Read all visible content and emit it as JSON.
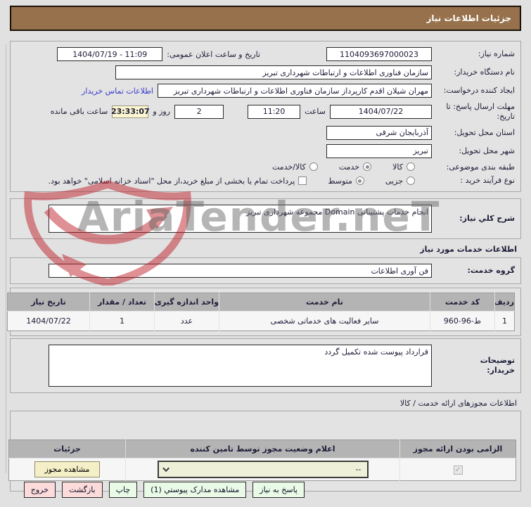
{
  "colors": {
    "header_bg": "#96714b",
    "page_bg": "#e1e1e1",
    "highlight_yellow": "#fdf5cf",
    "link_blue": "#3a3ace",
    "button_green": "#e9fbe7",
    "button_pink": "#fcdbdb",
    "table_header_gray": "#b4b4b4",
    "select_cream": "#eff0d8"
  },
  "header": {
    "title": "جزئیات اطلاعات نیاز"
  },
  "watermark": {
    "text": "AriaTender.neT",
    "shield_icon": "shield-arrow-logo"
  },
  "fields": {
    "need_number": {
      "label": "شماره نیاز:",
      "value": "1104093697000023"
    },
    "announce": {
      "label": "تاریخ و ساعت اعلان عمومی:",
      "value": "1404/07/19 - 11:09"
    },
    "buyer_org": {
      "label": "نام دستگاه خریدار:",
      "value": "سازمان فناوری اطلاعات و ارتباطات شهرداری تبریز"
    },
    "creator": {
      "label": "ایجاد کننده درخواست:",
      "value": "مهران شیلان اقدم کارپرداز سازمان فناوری اطلاعات و ارتباطات شهرداری تبریز",
      "contact_link": "اطلاعات تماس خریدار"
    },
    "deadline": {
      "label_line1": "مهلت ارسال پاسخ: تا",
      "label_line2": "تاریخ:",
      "date": "1404/07/22",
      "hour_label": "ساعت",
      "time": "11:20",
      "days": "2",
      "days_label": "روز و",
      "remaining": "23:33:07",
      "remaining_label": "ساعت باقی مانده"
    },
    "province": {
      "label": "استان محل تحویل:",
      "value": "آذربایجان شرقی"
    },
    "city": {
      "label": "شهر محل تحویل:",
      "value": "تبریز"
    },
    "classification": {
      "label": "طبقه بندی موضوعی:",
      "options": [
        {
          "label": "کالا",
          "selected": false
        },
        {
          "label": "خدمت",
          "selected": true
        },
        {
          "label": "کالا/خدمت",
          "selected": false
        }
      ]
    },
    "process": {
      "label": "نوع فرآیند خرید :",
      "options": [
        {
          "label": "جزیی",
          "selected": false
        },
        {
          "label": "متوسط",
          "selected": true
        }
      ],
      "treasury_checkbox_label": "پرداخت تمام یا بخشی از مبلغ خرید،از محل \"اسناد خزانه اسلامی\" خواهد بود.",
      "treasury_checked": false
    }
  },
  "need_desc": {
    "label": "شرح کلي نیاز:",
    "value": "انجام خدمات پشتیبانی Domain مجموعه شهرداری تبریز"
  },
  "services": {
    "heading": "اطلاعات خدمات مورد نیاز",
    "group_label": "گروه خدمت:",
    "group_value": "فن آوری اطلاعات",
    "table": {
      "headers": [
        "ردیف",
        "کد خدمت",
        "نام خدمت",
        "واحد اندازه گیری",
        "تعداد / مقدار",
        "تاریخ نیاز"
      ],
      "rows": [
        [
          "1",
          "ط-96-960",
          "سایر فعالیت های خدماتی شخصی",
          "عدد",
          "1",
          "1404/07/22"
        ]
      ]
    },
    "notes_label_line1": "توضیحات",
    "notes_label_line2": "خریدار:",
    "notes_value": "قرارداد پیوست شده تکمیل گردد"
  },
  "licenses": {
    "heading": "اطلاعات مجوزهای ارائه خدمت / کالا",
    "table": {
      "headers": [
        "الزامی بودن ارائه مجوز",
        "اعلام وضعیت مجوز توسط تامین کننده",
        "جزئیات"
      ],
      "row": {
        "required_checked": true,
        "check_icon": "check-icon",
        "status_value": "--",
        "details_button": "مشاهده مجوز"
      }
    }
  },
  "footer": {
    "buttons": [
      {
        "label": "پاسخ به نیاز",
        "style": "green"
      },
      {
        "label": "مشاهده مدارک پیوستي (1)",
        "style": "green"
      },
      {
        "label": "چاپ",
        "style": "green"
      },
      {
        "label": "بازگشت",
        "style": "pink"
      },
      {
        "label": "خروج",
        "style": "pink"
      }
    ]
  }
}
